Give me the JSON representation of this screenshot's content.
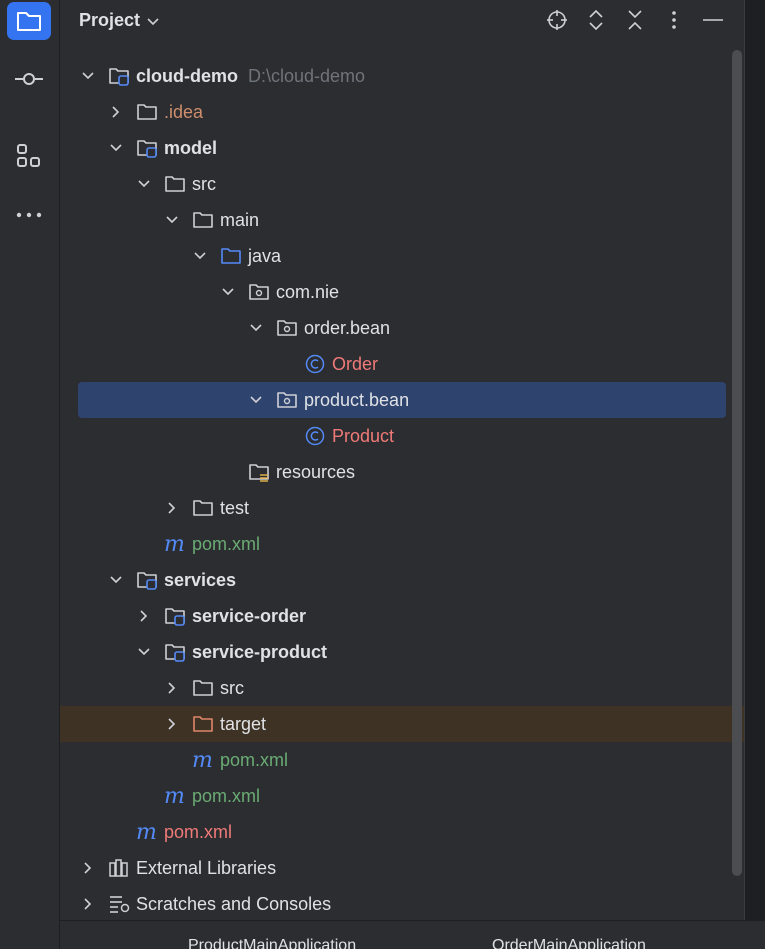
{
  "panel": {
    "title": "Project",
    "icons": [
      "locate-icon",
      "expand-all-icon",
      "collapse-all-icon",
      "more-options-icon",
      "minimize-icon"
    ]
  },
  "activity_bar": {
    "items": [
      "project-icon",
      "commit-icon",
      "structure-icon",
      "more-tools-icon"
    ]
  },
  "tree": [
    {
      "label": "cloud-demo",
      "hint": "D:\\cloud-demo",
      "icon": "module-folder-icon",
      "expanded": true,
      "bold": true
    },
    {
      "label": ".idea",
      "icon": "folder-icon",
      "expanded": false,
      "color": "#cf8e6d"
    },
    {
      "label": "model",
      "icon": "module-folder-icon",
      "expanded": true,
      "bold": true
    },
    {
      "label": "src",
      "icon": "folder-icon",
      "expanded": true
    },
    {
      "label": "main",
      "icon": "folder-icon",
      "expanded": true
    },
    {
      "label": "java",
      "icon": "source-folder-icon",
      "expanded": true
    },
    {
      "label": "com.nie",
      "icon": "package-icon",
      "expanded": true
    },
    {
      "label": "order.bean",
      "icon": "package-icon",
      "expanded": true
    },
    {
      "label": "Order",
      "icon": "class-icon",
      "color": "#f07a78"
    },
    {
      "label": "product.bean",
      "icon": "package-icon",
      "expanded": true,
      "selected": true
    },
    {
      "label": "Product",
      "icon": "class-icon",
      "color": "#f07a78"
    },
    {
      "label": "resources",
      "icon": "resources-folder-icon"
    },
    {
      "label": "test",
      "icon": "folder-icon",
      "expanded": false
    },
    {
      "label": "pom.xml",
      "icon": "maven-icon",
      "color": "#6aab73"
    },
    {
      "label": "services",
      "icon": "module-folder-icon",
      "expanded": true,
      "bold": true
    },
    {
      "label": "service-order",
      "icon": "module-folder-icon",
      "expanded": false,
      "bold": true
    },
    {
      "label": "service-product",
      "icon": "module-folder-icon",
      "expanded": true,
      "bold": true
    },
    {
      "label": "src",
      "icon": "folder-icon",
      "expanded": false
    },
    {
      "label": "target",
      "icon": "excluded-folder-icon",
      "expanded": false
    },
    {
      "label": "pom.xml",
      "icon": "maven-icon",
      "color": "#6aab73"
    },
    {
      "label": "pom.xml",
      "icon": "maven-icon",
      "color": "#6aab73"
    },
    {
      "label": "pom.xml",
      "icon": "maven-icon",
      "color": "#f07a78"
    },
    {
      "label": "External Libraries",
      "icon": "library-icon",
      "expanded": false
    },
    {
      "label": "Scratches and Consoles",
      "icon": "scratches-icon",
      "expanded": false
    }
  ],
  "bottom_bar": {
    "items": [
      "ProductMainApplication",
      "OrderMainApplication"
    ]
  },
  "colors": {
    "accent": "#3574f0",
    "selection": "#2e436e",
    "excluded": "#3d3223"
  }
}
